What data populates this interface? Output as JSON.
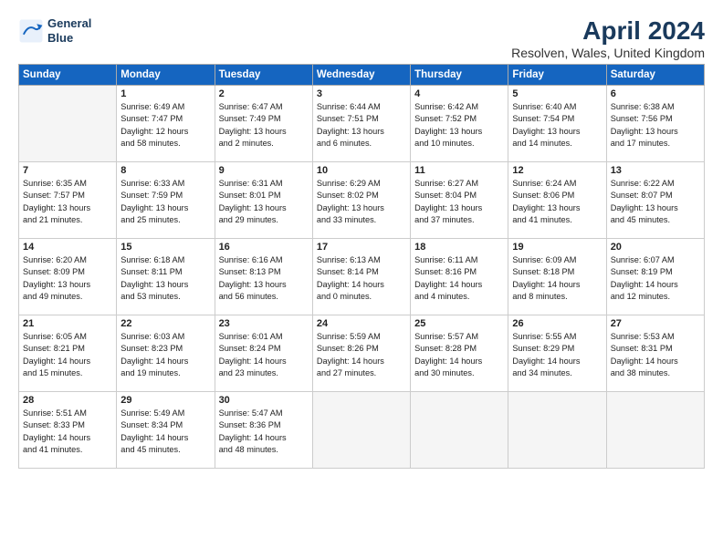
{
  "header": {
    "logo_line1": "General",
    "logo_line2": "Blue",
    "title": "April 2024",
    "subtitle": "Resolven, Wales, United Kingdom"
  },
  "days_of_week": [
    "Sunday",
    "Monday",
    "Tuesday",
    "Wednesday",
    "Thursday",
    "Friday",
    "Saturday"
  ],
  "weeks": [
    [
      {
        "day": "",
        "info": ""
      },
      {
        "day": "1",
        "info": "Sunrise: 6:49 AM\nSunset: 7:47 PM\nDaylight: 12 hours\nand 58 minutes."
      },
      {
        "day": "2",
        "info": "Sunrise: 6:47 AM\nSunset: 7:49 PM\nDaylight: 13 hours\nand 2 minutes."
      },
      {
        "day": "3",
        "info": "Sunrise: 6:44 AM\nSunset: 7:51 PM\nDaylight: 13 hours\nand 6 minutes."
      },
      {
        "day": "4",
        "info": "Sunrise: 6:42 AM\nSunset: 7:52 PM\nDaylight: 13 hours\nand 10 minutes."
      },
      {
        "day": "5",
        "info": "Sunrise: 6:40 AM\nSunset: 7:54 PM\nDaylight: 13 hours\nand 14 minutes."
      },
      {
        "day": "6",
        "info": "Sunrise: 6:38 AM\nSunset: 7:56 PM\nDaylight: 13 hours\nand 17 minutes."
      }
    ],
    [
      {
        "day": "7",
        "info": "Sunrise: 6:35 AM\nSunset: 7:57 PM\nDaylight: 13 hours\nand 21 minutes."
      },
      {
        "day": "8",
        "info": "Sunrise: 6:33 AM\nSunset: 7:59 PM\nDaylight: 13 hours\nand 25 minutes."
      },
      {
        "day": "9",
        "info": "Sunrise: 6:31 AM\nSunset: 8:01 PM\nDaylight: 13 hours\nand 29 minutes."
      },
      {
        "day": "10",
        "info": "Sunrise: 6:29 AM\nSunset: 8:02 PM\nDaylight: 13 hours\nand 33 minutes."
      },
      {
        "day": "11",
        "info": "Sunrise: 6:27 AM\nSunset: 8:04 PM\nDaylight: 13 hours\nand 37 minutes."
      },
      {
        "day": "12",
        "info": "Sunrise: 6:24 AM\nSunset: 8:06 PM\nDaylight: 13 hours\nand 41 minutes."
      },
      {
        "day": "13",
        "info": "Sunrise: 6:22 AM\nSunset: 8:07 PM\nDaylight: 13 hours\nand 45 minutes."
      }
    ],
    [
      {
        "day": "14",
        "info": "Sunrise: 6:20 AM\nSunset: 8:09 PM\nDaylight: 13 hours\nand 49 minutes."
      },
      {
        "day": "15",
        "info": "Sunrise: 6:18 AM\nSunset: 8:11 PM\nDaylight: 13 hours\nand 53 minutes."
      },
      {
        "day": "16",
        "info": "Sunrise: 6:16 AM\nSunset: 8:13 PM\nDaylight: 13 hours\nand 56 minutes."
      },
      {
        "day": "17",
        "info": "Sunrise: 6:13 AM\nSunset: 8:14 PM\nDaylight: 14 hours\nand 0 minutes."
      },
      {
        "day": "18",
        "info": "Sunrise: 6:11 AM\nSunset: 8:16 PM\nDaylight: 14 hours\nand 4 minutes."
      },
      {
        "day": "19",
        "info": "Sunrise: 6:09 AM\nSunset: 8:18 PM\nDaylight: 14 hours\nand 8 minutes."
      },
      {
        "day": "20",
        "info": "Sunrise: 6:07 AM\nSunset: 8:19 PM\nDaylight: 14 hours\nand 12 minutes."
      }
    ],
    [
      {
        "day": "21",
        "info": "Sunrise: 6:05 AM\nSunset: 8:21 PM\nDaylight: 14 hours\nand 15 minutes."
      },
      {
        "day": "22",
        "info": "Sunrise: 6:03 AM\nSunset: 8:23 PM\nDaylight: 14 hours\nand 19 minutes."
      },
      {
        "day": "23",
        "info": "Sunrise: 6:01 AM\nSunset: 8:24 PM\nDaylight: 14 hours\nand 23 minutes."
      },
      {
        "day": "24",
        "info": "Sunrise: 5:59 AM\nSunset: 8:26 PM\nDaylight: 14 hours\nand 27 minutes."
      },
      {
        "day": "25",
        "info": "Sunrise: 5:57 AM\nSunset: 8:28 PM\nDaylight: 14 hours\nand 30 minutes."
      },
      {
        "day": "26",
        "info": "Sunrise: 5:55 AM\nSunset: 8:29 PM\nDaylight: 14 hours\nand 34 minutes."
      },
      {
        "day": "27",
        "info": "Sunrise: 5:53 AM\nSunset: 8:31 PM\nDaylight: 14 hours\nand 38 minutes."
      }
    ],
    [
      {
        "day": "28",
        "info": "Sunrise: 5:51 AM\nSunset: 8:33 PM\nDaylight: 14 hours\nand 41 minutes."
      },
      {
        "day": "29",
        "info": "Sunrise: 5:49 AM\nSunset: 8:34 PM\nDaylight: 14 hours\nand 45 minutes."
      },
      {
        "day": "30",
        "info": "Sunrise: 5:47 AM\nSunset: 8:36 PM\nDaylight: 14 hours\nand 48 minutes."
      },
      {
        "day": "",
        "info": ""
      },
      {
        "day": "",
        "info": ""
      },
      {
        "day": "",
        "info": ""
      },
      {
        "day": "",
        "info": ""
      }
    ]
  ]
}
